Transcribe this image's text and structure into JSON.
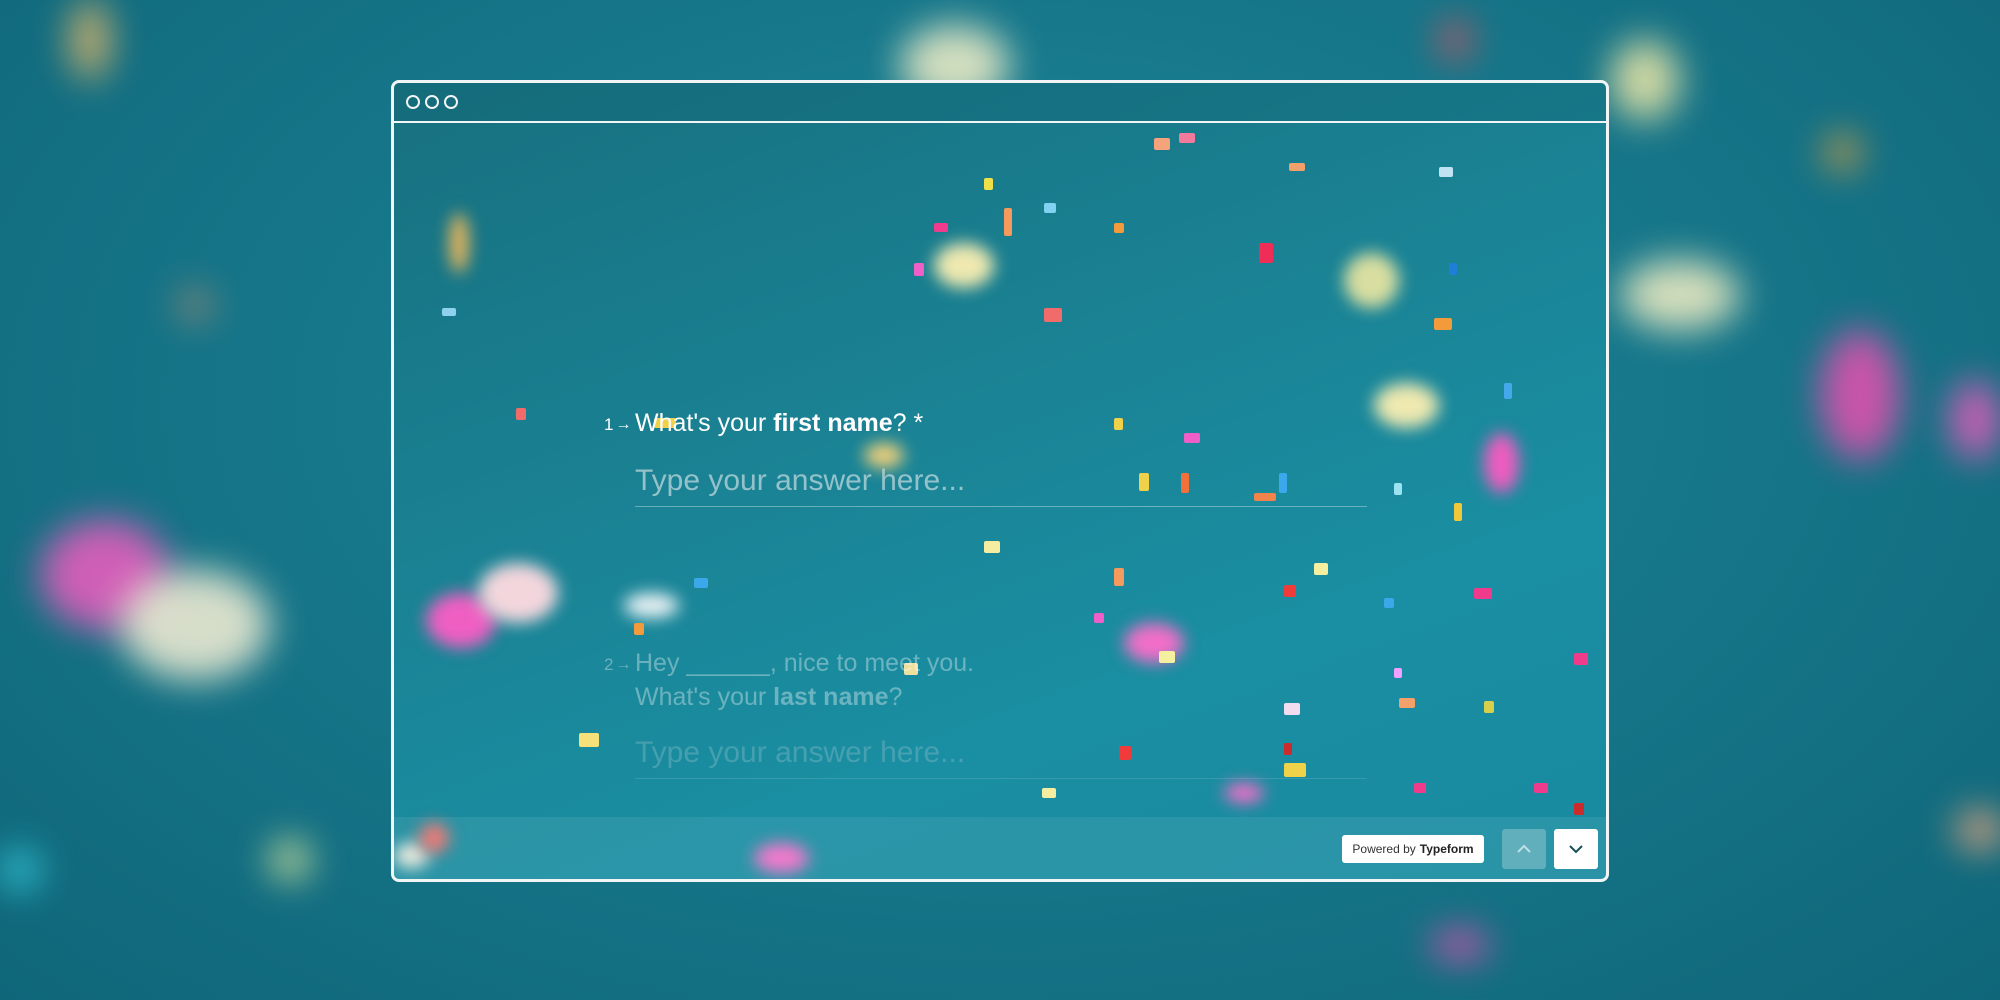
{
  "browser": {
    "window_controls": [
      "close-dot",
      "minimize-dot",
      "maximize-dot"
    ]
  },
  "form": {
    "questions": [
      {
        "number": "1",
        "text_before": "What's your ",
        "text_bold": "first name",
        "text_after": "? *",
        "input_placeholder": "Type your answer here..."
      },
      {
        "number": "2",
        "line1": "Hey ______, nice to meet you.",
        "line2_before": "What's your ",
        "line2_bold": "last name",
        "line2_after": "?",
        "input_placeholder": "Type your answer here..."
      }
    ]
  },
  "footer": {
    "powered_prefix": "Powered by",
    "powered_brand": "Typeform",
    "prev_icon": "chevron-up-icon",
    "next_icon": "chevron-down-icon"
  },
  "colors": {
    "background": "#1a8496",
    "text": "#ffffff",
    "frame": "#f1f5f6"
  }
}
